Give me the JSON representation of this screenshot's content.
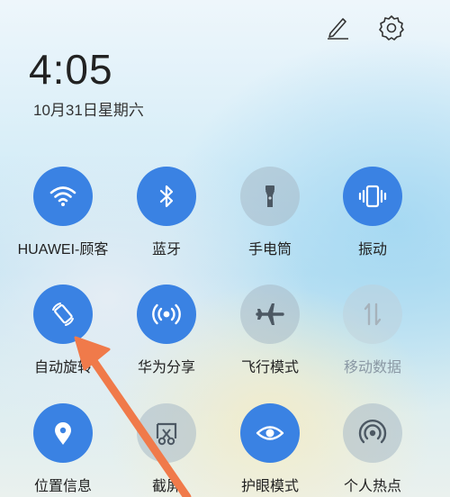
{
  "header": {
    "time": "4:05",
    "date": "10月31日星期六"
  },
  "tiles": [
    {
      "label": "HUAWEI-顾客",
      "icon": "wifi-icon",
      "active": true
    },
    {
      "label": "蓝牙",
      "icon": "bluetooth-icon",
      "active": true
    },
    {
      "label": "手电筒",
      "icon": "flashlight-icon",
      "active": false
    },
    {
      "label": "振动",
      "icon": "vibrate-icon",
      "active": true
    },
    {
      "label": "自动旋转",
      "icon": "auto-rotate-icon",
      "active": true
    },
    {
      "label": "华为分享",
      "icon": "huawei-share-icon",
      "active": true
    },
    {
      "label": "飞行模式",
      "icon": "airplane-icon",
      "active": false
    },
    {
      "label": "移动数据",
      "icon": "mobile-data-icon",
      "active": false,
      "disabled": true
    },
    {
      "label": "位置信息",
      "icon": "location-icon",
      "active": true
    },
    {
      "label": "截屏",
      "icon": "screenshot-icon",
      "active": false
    },
    {
      "label": "护眼模式",
      "icon": "eye-comfort-icon",
      "active": true
    },
    {
      "label": "个人热点",
      "icon": "hotspot-icon",
      "active": false
    }
  ],
  "colors": {
    "active": "#3a82e3",
    "annotation_arrow": "#f07a4a"
  }
}
